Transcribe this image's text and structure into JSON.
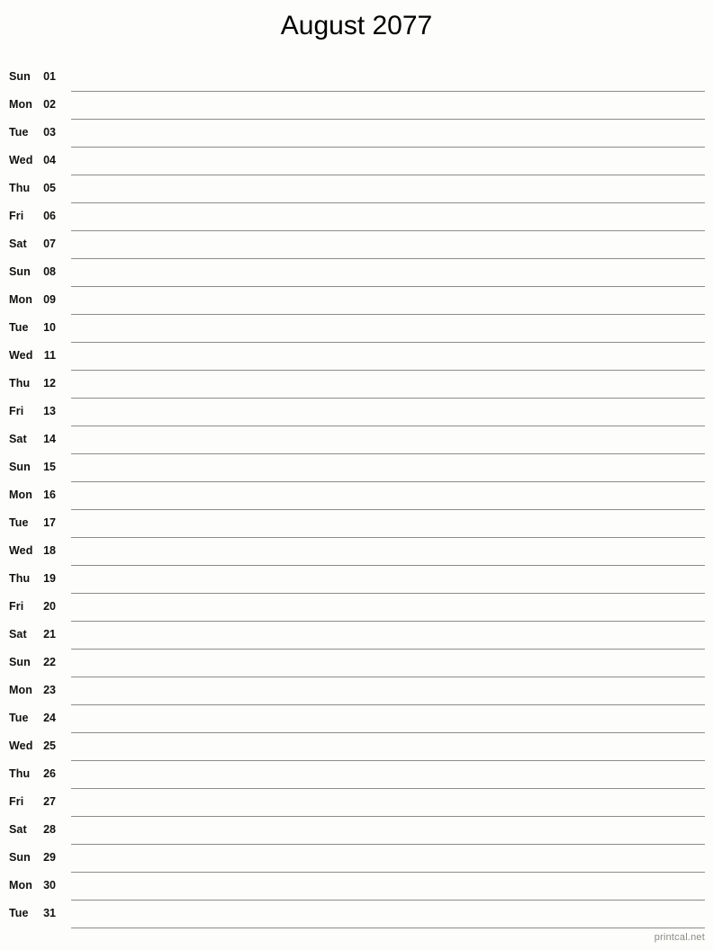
{
  "document": {
    "title": "August 2077",
    "month": "August",
    "year": "2077",
    "footer": "printcal.net",
    "colors": {
      "background": "#fdfdfb",
      "text": "#111111",
      "line": "#8c8c87",
      "footer_text": "#8a8a85"
    }
  },
  "rows": [
    {
      "weekday": "Sun",
      "date": "01"
    },
    {
      "weekday": "Mon",
      "date": "02"
    },
    {
      "weekday": "Tue",
      "date": "03"
    },
    {
      "weekday": "Wed",
      "date": "04"
    },
    {
      "weekday": "Thu",
      "date": "05"
    },
    {
      "weekday": "Fri",
      "date": "06"
    },
    {
      "weekday": "Sat",
      "date": "07"
    },
    {
      "weekday": "Sun",
      "date": "08"
    },
    {
      "weekday": "Mon",
      "date": "09"
    },
    {
      "weekday": "Tue",
      "date": "10"
    },
    {
      "weekday": "Wed",
      "date": "11"
    },
    {
      "weekday": "Thu",
      "date": "12"
    },
    {
      "weekday": "Fri",
      "date": "13"
    },
    {
      "weekday": "Sat",
      "date": "14"
    },
    {
      "weekday": "Sun",
      "date": "15"
    },
    {
      "weekday": "Mon",
      "date": "16"
    },
    {
      "weekday": "Tue",
      "date": "17"
    },
    {
      "weekday": "Wed",
      "date": "18"
    },
    {
      "weekday": "Thu",
      "date": "19"
    },
    {
      "weekday": "Fri",
      "date": "20"
    },
    {
      "weekday": "Sat",
      "date": "21"
    },
    {
      "weekday": "Sun",
      "date": "22"
    },
    {
      "weekday": "Mon",
      "date": "23"
    },
    {
      "weekday": "Tue",
      "date": "24"
    },
    {
      "weekday": "Wed",
      "date": "25"
    },
    {
      "weekday": "Thu",
      "date": "26"
    },
    {
      "weekday": "Fri",
      "date": "27"
    },
    {
      "weekday": "Sat",
      "date": "28"
    },
    {
      "weekday": "Sun",
      "date": "29"
    },
    {
      "weekday": "Mon",
      "date": "30"
    },
    {
      "weekday": "Tue",
      "date": "31"
    }
  ]
}
